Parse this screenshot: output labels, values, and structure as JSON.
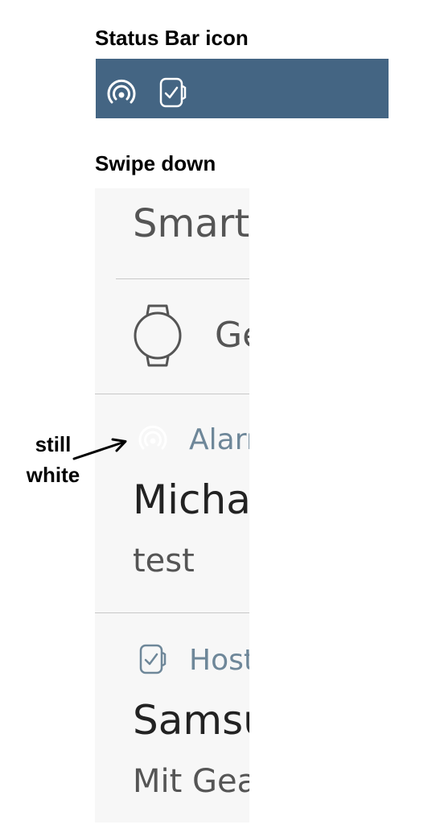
{
  "labels": {
    "status_bar": "Status Bar icon",
    "swipe_down": "Swipe down"
  },
  "status_bar": {
    "background": "#446583",
    "icons": [
      "broadcast-icon",
      "watch-icon"
    ]
  },
  "shade": {
    "background": "#f7f7f7",
    "app_title": "SmartT",
    "device_row": {
      "icon": "round-watch-icon",
      "label": "Ge"
    },
    "notifications": [
      {
        "icon": "broadcast-icon",
        "icon_color": "#ffffff",
        "app_name": "Alarm",
        "title": "Micha",
        "body": "test"
      },
      {
        "icon": "watch-icon",
        "icon_color": "#6e8799",
        "app_name": "Host",
        "title": "Samsu",
        "body": "Mit Gea"
      }
    ]
  },
  "annotation": {
    "line1": "still",
    "line2": "white"
  }
}
